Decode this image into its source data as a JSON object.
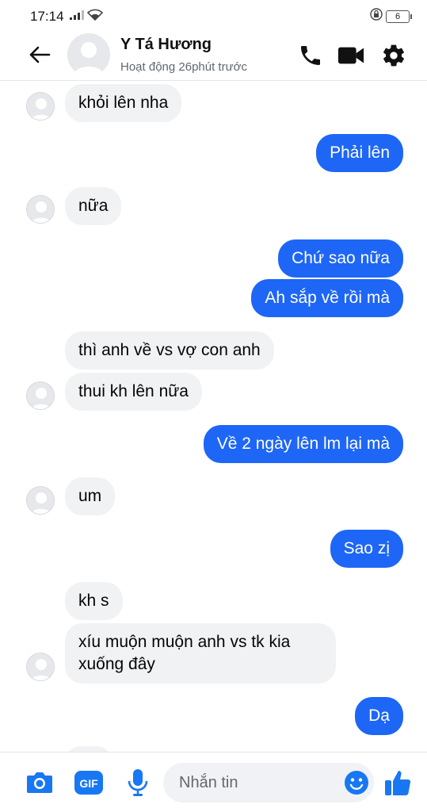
{
  "status_bar": {
    "time": "17:14",
    "battery": "6"
  },
  "header": {
    "contact_name": "Y Tá Hương",
    "contact_status": "Hoạt động 26phút trước"
  },
  "messages": [
    {
      "side": "in",
      "text": "khỏi lên nha"
    },
    {
      "side": "out",
      "text": "Phải lên"
    },
    {
      "side": "in",
      "text": "nữa"
    },
    {
      "side": "out",
      "text": "Chứ sao nữa"
    },
    {
      "side": "out",
      "text": "Ah sắp về rồi mà"
    },
    {
      "side": "in",
      "text": "thì anh về vs vợ con anh"
    },
    {
      "side": "in",
      "text": "thui kh lên nữa"
    },
    {
      "side": "out",
      "text": "Về 2 ngày lên lm lại mà"
    },
    {
      "side": "in",
      "text": "um"
    },
    {
      "side": "out",
      "text": "Sao zị"
    },
    {
      "side": "in",
      "text": "kh s"
    },
    {
      "side": "in",
      "text": "xíu muộn muộn anh vs tk kia xuống đây"
    },
    {
      "side": "out",
      "text": "Dạ"
    }
  ],
  "composer": {
    "placeholder": "Nhắn tin",
    "gif_label": "GIF"
  },
  "colors": {
    "outgoing_bubble": "#1e66f5",
    "incoming_bubble": "#f1f2f4",
    "accent": "#1877f2"
  },
  "icons": [
    "back-arrow-icon",
    "phone-icon",
    "video-camera-icon",
    "gear-icon",
    "camera-icon",
    "gif-icon",
    "microphone-icon",
    "emoji-icon",
    "thumbs-up-icon"
  ]
}
